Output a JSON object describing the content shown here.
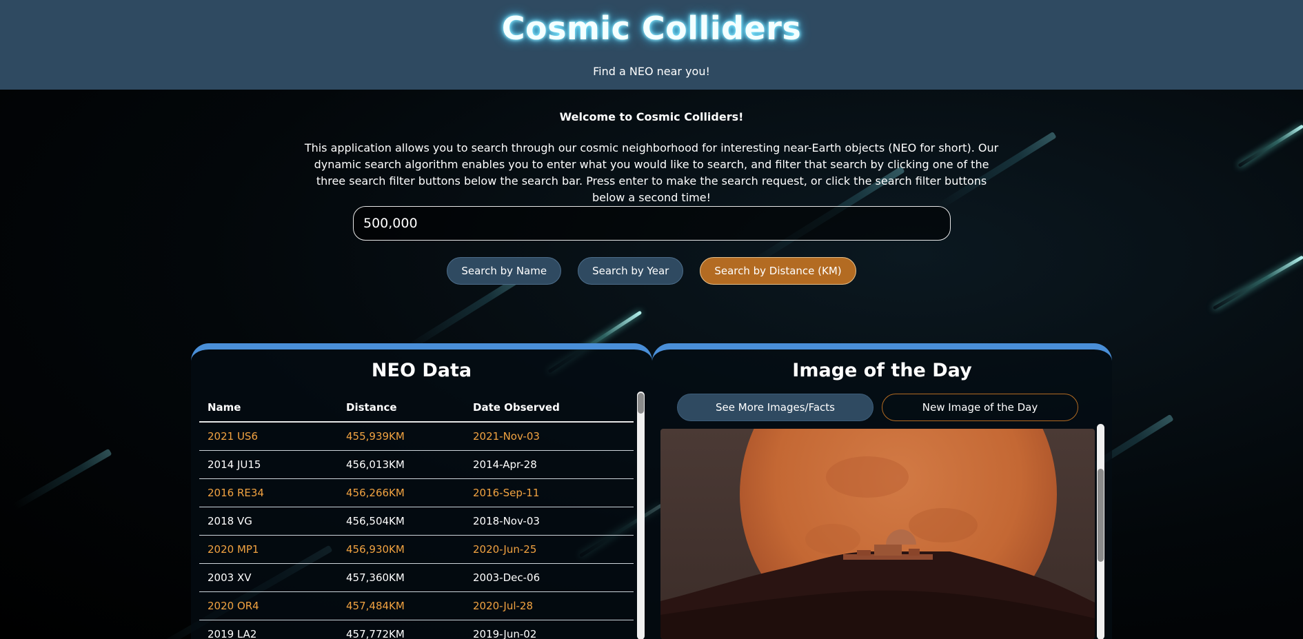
{
  "header": {
    "title": "Cosmic Colliders",
    "tagline": "Find a NEO near you!"
  },
  "intro": {
    "welcome": "Welcome to Cosmic Colliders!",
    "description": "This application allows you to search through our cosmic neighborhood for interesting near-Earth objects (NEO for short). Our dynamic search algorithm enables you to enter what you would like to search, and filter that search by clicking one of the three search filter buttons below the search bar. Press enter to make the search request, or click the search filter buttons below a second time!"
  },
  "search": {
    "value": "500,000",
    "placeholder": ""
  },
  "filters": [
    {
      "label": "Search by Name",
      "active": false
    },
    {
      "label": "Search by Year",
      "active": false
    },
    {
      "label": "Search by Distance (KM)",
      "active": true
    }
  ],
  "neo_panel": {
    "title": "NEO Data",
    "columns": [
      "Name",
      "Distance",
      "Date Observed"
    ],
    "rows": [
      [
        "2021 US6",
        "455,939KM",
        "2021-Nov-03"
      ],
      [
        "2014 JU15",
        "456,013KM",
        "2014-Apr-28"
      ],
      [
        "2016 RE34",
        "456,266KM",
        "2016-Sep-11"
      ],
      [
        "2018 VG",
        "456,504KM",
        "2018-Nov-03"
      ],
      [
        "2020 MP1",
        "456,930KM",
        "2020-Jun-25"
      ],
      [
        "2003 XV",
        "457,360KM",
        "2003-Dec-06"
      ],
      [
        "2020 OR4",
        "457,484KM",
        "2020-Jul-28"
      ],
      [
        "2019 LA2",
        "457,772KM",
        "2019-Jun-02"
      ]
    ]
  },
  "image_panel": {
    "title": "Image of the Day",
    "more_label": "See More Images/Facts",
    "new_label": "New Image of the Day"
  },
  "colors": {
    "header_bg": "#2f4a61",
    "accent_orange": "#b36b22",
    "row_orange": "#f2a341",
    "panel_border": "#4a8fd8"
  }
}
